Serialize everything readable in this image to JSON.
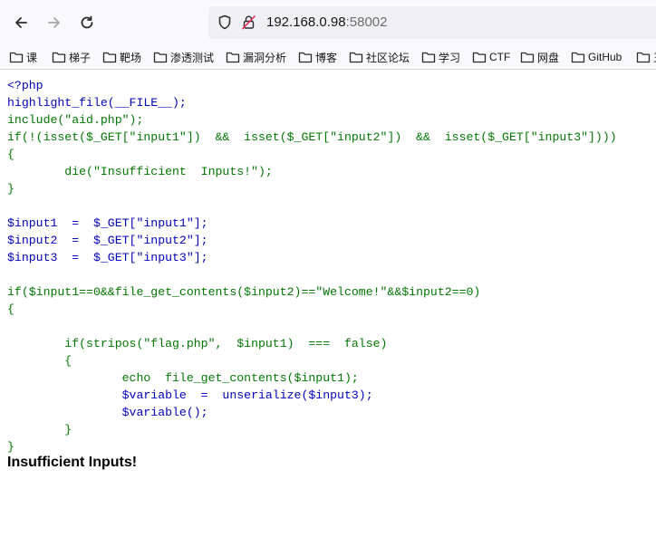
{
  "url": {
    "host": "192.168.0.98",
    "port": ":58002"
  },
  "bookmarks": [
    "课",
    "梯子",
    "靶场",
    "渗透测试",
    "漏洞分析",
    "博客",
    "社区论坛",
    "学习",
    "CTF",
    "网盘",
    "GitHub",
    "王"
  ],
  "code_lines": [
    "<?php",
    "highlight_file(__FILE__);",
    "include(\"aid.php\");",
    "if(!(isset($_GET[\"input1\"])  &&  isset($_GET[\"input2\"])  &&  isset($_GET[\"input3\"])))",
    "{",
    "        die(\"Insufficient  Inputs!\");",
    "}",
    "",
    "$input1  =  $_GET[\"input1\"];",
    "$input2  =  $_GET[\"input2\"];",
    "$input3  =  $_GET[\"input3\"];",
    "",
    "if($input1==0&&file_get_contents($input2)==\"Welcome!\"&&$input2==0)",
    "{",
    "",
    "        if(stripos(\"flag.php\",  $input1)  ===  false)",
    "        {",
    "                echo  file_get_contents($input1);",
    "                $variable  =  unserialize($input3);",
    "                $variable();",
    "        }",
    "}"
  ],
  "output_message": "Insufficient Inputs!"
}
